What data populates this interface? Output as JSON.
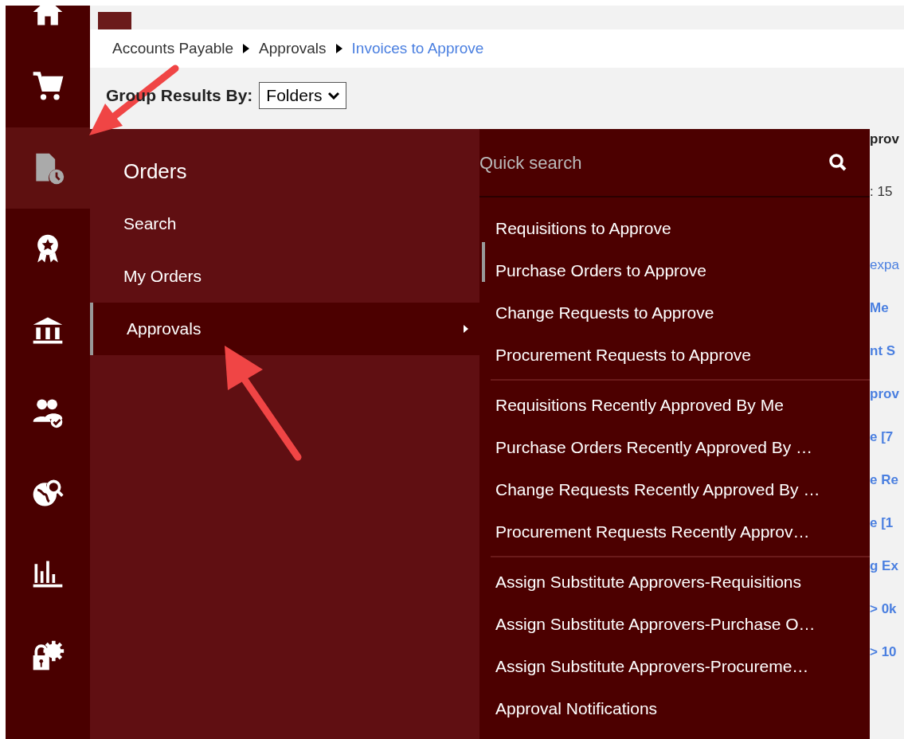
{
  "sidebar": {
    "items": [
      {
        "selected": false
      },
      {
        "selected": false
      },
      {
        "selected": true
      },
      {
        "selected": false
      },
      {
        "selected": false
      },
      {
        "selected": false
      },
      {
        "selected": false
      },
      {
        "selected": false
      },
      {
        "selected": false
      }
    ]
  },
  "breadcrumb": [
    {
      "label": "Accounts Payable",
      "current": false
    },
    {
      "label": "Approvals",
      "current": false
    },
    {
      "label": "Invoices to Approve",
      "current": true
    }
  ],
  "group_results": {
    "label": "Group Results By:",
    "value": "Folders"
  },
  "background_fragments": [
    {
      "text": "prov",
      "kind": "bold"
    },
    {
      "text": ": 15",
      "kind": "plain"
    },
    {
      "text": "expa",
      "kind": "link"
    },
    {
      "text": "Me",
      "kind": "bluebold"
    },
    {
      "text": "nt S",
      "kind": "bluebold"
    },
    {
      "text": "prov",
      "kind": "bluebold"
    },
    {
      "text": "e [7",
      "kind": "bluebold"
    },
    {
      "text": "e Re",
      "kind": "bluebold"
    },
    {
      "text": "e [1",
      "kind": "bluebold"
    },
    {
      "text": "g Ex",
      "kind": "bluebold"
    },
    {
      "text": "> 0k",
      "kind": "bluebold"
    },
    {
      "text": "> 10",
      "kind": "bluebold"
    }
  ],
  "menu": {
    "title": "Orders",
    "items": [
      {
        "label": "Search",
        "selected": false
      },
      {
        "label": "My Orders",
        "selected": false
      },
      {
        "label": "Approvals",
        "selected": true
      }
    ],
    "quick_search": {
      "placeholder": "Quick search"
    },
    "submenu_groups": [
      [
        "Requisitions to Approve",
        "Purchase Orders to Approve",
        "Change Requests to Approve",
        "Procurement Requests to Approve"
      ],
      [
        "Requisitions Recently Approved By Me",
        "Purchase Orders Recently Approved By …",
        "Change Requests Recently Approved By …",
        "Procurement Requests Recently Approv…"
      ],
      [
        "Assign Substitute Approvers-Requisitions",
        "Assign Substitute Approvers-Purchase O…",
        "Assign Substitute Approvers-Procureme…",
        "Approval Notifications"
      ]
    ]
  }
}
